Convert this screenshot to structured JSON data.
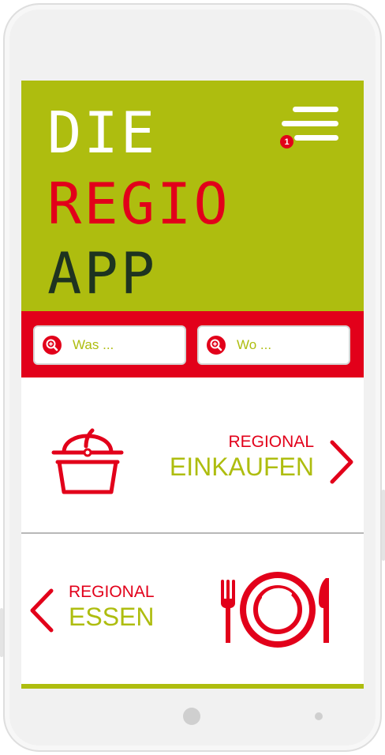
{
  "logo": {
    "line1": "DIE",
    "line2": "REGIO",
    "line3": "APP"
  },
  "menu": {
    "badge_count": "1",
    "icon": "hamburger-menu-icon"
  },
  "search": {
    "what": {
      "placeholder": "Was ...",
      "icon": "search-icon"
    },
    "where": {
      "placeholder": "Wo ...",
      "icon": "search-icon"
    }
  },
  "tiles": {
    "einkaufen": {
      "kicker": "REGIONAL",
      "title": "EINKAUFEN",
      "icon": "shopping-basket-icon",
      "arrow": "chevron-right-icon"
    },
    "essen": {
      "kicker": "REGIONAL",
      "title": "ESSEN",
      "icon": "plate-cutlery-icon",
      "arrow": "chevron-left-icon"
    }
  },
  "colors": {
    "accent_green": "#aebd0f",
    "accent_red": "#e2001a",
    "dark_green": "#1e3320"
  }
}
